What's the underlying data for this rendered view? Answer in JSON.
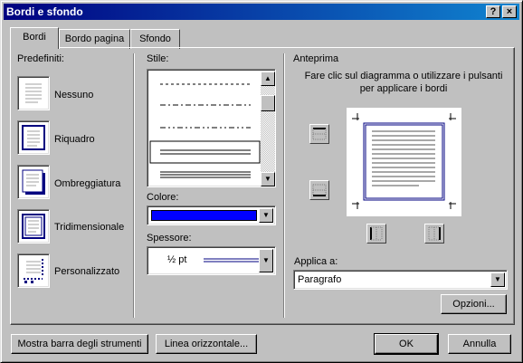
{
  "window": {
    "title": "Bordi e sfondo",
    "help_label": "?",
    "close_label": "×"
  },
  "tabs": [
    {
      "label": "Bordi"
    },
    {
      "label": "Bordo pagina"
    },
    {
      "label": "Sfondo"
    }
  ],
  "predefiniti": {
    "title": "Predefiniti:",
    "items": [
      {
        "label": "Nessuno",
        "icon": "none-border-icon"
      },
      {
        "label": "Riquadro",
        "icon": "box-border-icon"
      },
      {
        "label": "Ombreggiatura",
        "icon": "shadow-border-icon"
      },
      {
        "label": "Tridimensionale",
        "icon": "3d-border-icon"
      },
      {
        "label": "Personalizzato",
        "icon": "custom-border-icon"
      }
    ]
  },
  "stile": {
    "title": "Stile:",
    "line_styles": [
      "dashed",
      "dash-dot",
      "dash-dot-dot",
      "double",
      "triple"
    ]
  },
  "colore": {
    "title": "Colore:",
    "value_color": "#0000ff"
  },
  "spessore": {
    "title": "Spessore:",
    "value": "½ pt"
  },
  "anteprima": {
    "title": "Anteprima",
    "instructions": "Fare clic sul diagramma o utilizzare i pulsanti per applicare i bordi"
  },
  "applica": {
    "title": "Applica a:",
    "value": "Paragrafo"
  },
  "buttons": {
    "opzioni": "Opzioni...",
    "mostra_barra": "Mostra barra degli strumenti",
    "linea_orizzontale": "Linea orizzontale...",
    "ok": "OK",
    "annulla": "Annulla"
  },
  "colors": {
    "title_bar_start": "#000080",
    "title_bar_end": "#1084d0",
    "border_color": "#000080"
  }
}
